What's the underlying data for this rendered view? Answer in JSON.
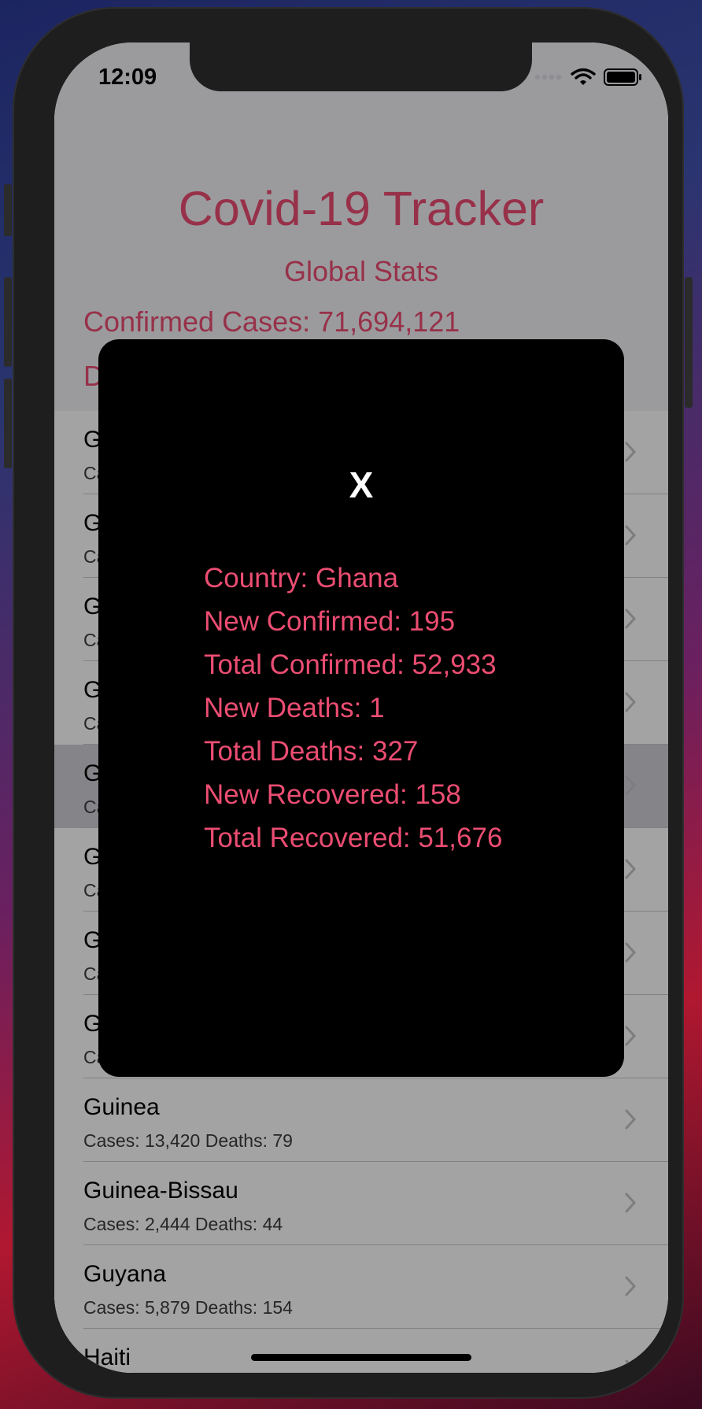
{
  "status_bar": {
    "time": "12:09"
  },
  "header": {
    "title": "Covid-19 Tracker",
    "subtitle": "Global Stats",
    "confirmed_line": "Confirmed Cases: 71,694,121",
    "second_line_partial": "D"
  },
  "list": {
    "rows": [
      {
        "name": "G",
        "sub": "Ca"
      },
      {
        "name": "G",
        "sub": "Ca"
      },
      {
        "name": "G",
        "sub": "Ca"
      },
      {
        "name": "G",
        "sub": "Ca"
      },
      {
        "name": "G",
        "sub": "Ca"
      },
      {
        "name": "G",
        "sub": "Ca"
      },
      {
        "name": "G",
        "sub": "Ca"
      },
      {
        "name": "G",
        "sub": "Ca"
      },
      {
        "name": "Guinea",
        "sub": "Cases: 13,420 Deaths: 79"
      },
      {
        "name": "Guinea-Bissau",
        "sub": "Cases: 2,444 Deaths: 44"
      },
      {
        "name": "Guyana",
        "sub": "Cases: 5,879 Deaths: 154"
      },
      {
        "name": "Haiti",
        "sub": ""
      }
    ]
  },
  "modal": {
    "close_label": "X",
    "country": "Country: Ghana",
    "new_confirmed": "New Confirmed: 195",
    "total_confirmed": "Total Confirmed: 52,933",
    "new_deaths": "New Deaths: 1",
    "total_deaths": "Total Deaths: 327",
    "new_recovered": "New Recovered: 158",
    "total_recovered": "Total Recovered: 51,676"
  },
  "colors": {
    "accent": "#ec4d72",
    "modal_bg": "#000000"
  }
}
